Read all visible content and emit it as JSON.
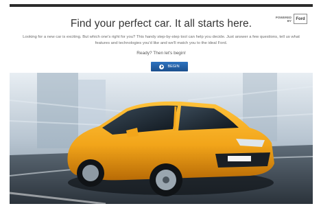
{
  "page": {
    "headline": "Find your perfect car. It all starts here.",
    "description": "Looking for a new car is exciting. But which one's right for you? This handy step-by-step tool can help you decide. Just answer a few questions, tell us what features and technologies you'd like and we'll match you to the ideal Ford.",
    "prompt": "Ready? Then let's begin!",
    "begin_label": "BEGIN"
  },
  "powered": {
    "line1": "POWERED",
    "line2": "BY",
    "logo_text": "Ford"
  },
  "colors": {
    "button": "#1f5fa8",
    "car_body": "#f2a51a",
    "headline_text": "#333333"
  },
  "icons": {
    "begin": "play-circle-icon"
  }
}
